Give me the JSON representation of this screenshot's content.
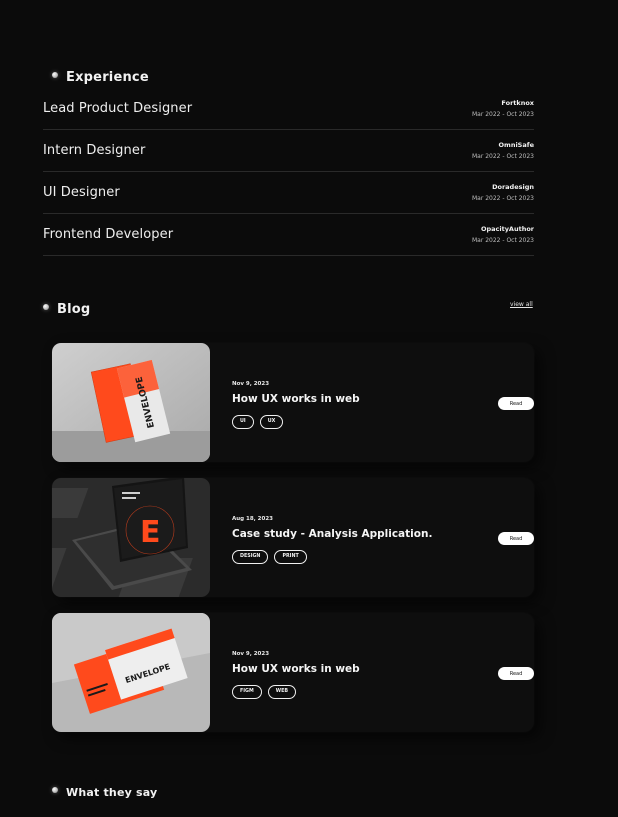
{
  "experience": {
    "title": "Experience",
    "items": [
      {
        "role": "Lead Product Designer",
        "company": "Fortknox",
        "dates": "Mar 2022 - Oct 2023"
      },
      {
        "role": "Intern Designer",
        "company": "OmniSafe",
        "dates": "Mar 2022 - Oct 2023"
      },
      {
        "role": "UI Designer",
        "company": "Doradesign",
        "dates": "Mar 2022 - Oct 2023"
      },
      {
        "role": "Frontend Developer",
        "company": "OpacityAuthor",
        "dates": "Mar 2022 - Oct 2023"
      }
    ]
  },
  "blog": {
    "title": "Blog",
    "view_all": "view all",
    "posts": [
      {
        "date": "Nov 9, 2023",
        "title": "How UX works in web",
        "tags": [
          "UI",
          "UX"
        ],
        "read_label": "Read"
      },
      {
        "date": "Aug 18, 2023",
        "title": "Case study - Analysis Application.",
        "tags": [
          "DESIGN",
          "PRINT"
        ],
        "read_label": "Read"
      },
      {
        "date": "Nov 9, 2023",
        "title": "How UX works in web",
        "tags": [
          "FIGM",
          "WEB"
        ],
        "read_label": "Read"
      }
    ]
  },
  "testimonials": {
    "title": "What they say"
  },
  "thumb_text": {
    "brand": "ENVELOPE",
    "letter": "E"
  },
  "colors": {
    "background": "#0b0b0b",
    "accent": "#ff4a1c"
  }
}
